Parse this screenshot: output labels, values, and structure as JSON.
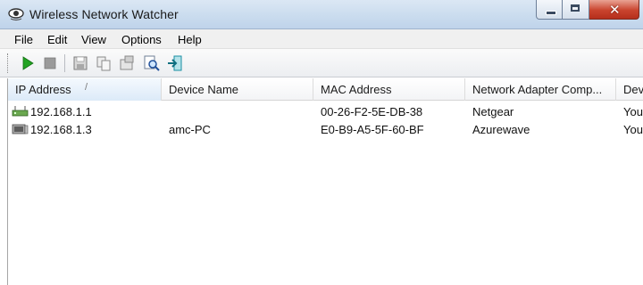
{
  "window": {
    "title": "Wireless Network Watcher",
    "app_icon": "eye-icon",
    "controls": [
      "minimize-icon",
      "maximize-icon",
      "close-icon"
    ]
  },
  "menu": {
    "items": [
      "File",
      "Edit",
      "View",
      "Options",
      "Help"
    ]
  },
  "toolbar": {
    "buttons": [
      "play-icon",
      "stop-icon",
      "save-icon",
      "copy-icon",
      "properties-icon",
      "find-icon",
      "exit-icon"
    ]
  },
  "table": {
    "columns": [
      {
        "label": "IP Address",
        "sorted": true
      },
      {
        "label": "Device Name"
      },
      {
        "label": "MAC Address"
      },
      {
        "label": "Network Adapter Comp..."
      },
      {
        "label": "Dev"
      }
    ],
    "sort_indicator": "/",
    "rows": [
      {
        "icon": "router-icon",
        "ip": "192.168.1.1",
        "device": "",
        "mac": "00-26-F2-5E-DB-38",
        "adapter": "Netgear",
        "extra": "You"
      },
      {
        "icon": "computer-icon",
        "ip": "192.168.1.3",
        "device": "amc-PC",
        "mac": "E0-B9-A5-5F-60-BF",
        "adapter": "Azurewave",
        "extra": "You"
      }
    ]
  },
  "colors": {
    "titlebar": "#c9dbee",
    "close_button": "#c9432d",
    "play_green": "#23a323",
    "exit_teal": "#1a8fa3"
  }
}
